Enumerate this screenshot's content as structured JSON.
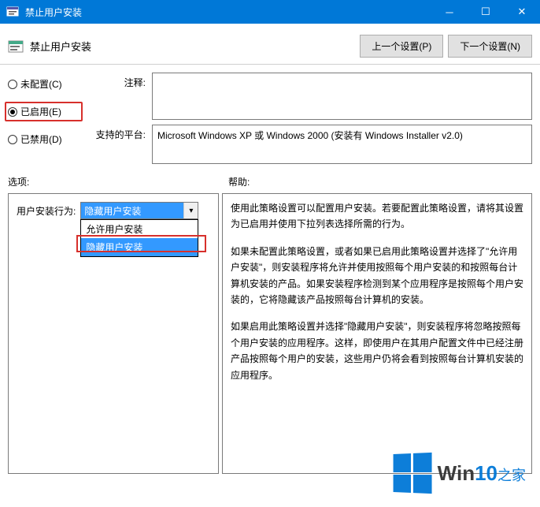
{
  "titlebar": {
    "title": "禁止用户安装"
  },
  "toprow": {
    "title": "禁止用户安装",
    "prev": "上一个设置(P)",
    "next": "下一个设置(N)"
  },
  "radios": {
    "unconfigured": "未配置(C)",
    "enabled": "已启用(E)",
    "disabled": "已禁用(D)"
  },
  "fields": {
    "comment_label": "注释:",
    "comment_value": "",
    "platform_label": "支持的平台:",
    "platform_value": "Microsoft Windows XP 或 Windows 2000 (安装有 Windows Installer v2.0)"
  },
  "mid": {
    "options": "选项:",
    "help": "帮助:"
  },
  "option": {
    "label": "用户安装行为:",
    "selected": "隐藏用户安装",
    "items": [
      "允许用户安装",
      "隐藏用户安装"
    ]
  },
  "help": {
    "p1": "使用此策略设置可以配置用户安装。若要配置此策略设置，请将其设置为已启用并使用下拉列表选择所需的行为。",
    "p2": "如果未配置此策略设置，或者如果已启用此策略设置并选择了\"允许用户安装\"，则安装程序将允许并使用按照每个用户安装的和按照每台计算机安装的产品。如果安装程序检测到某个应用程序是按照每个用户安装的，它将隐藏该产品按照每台计算机的安装。",
    "p3": "如果启用此策略设置并选择\"隐藏用户安装\"，则安装程序将忽略按照每个用户安装的应用程序。这样，即使用户在其用户配置文件中已经注册产品按照每个用户的安装，这些用户仍将会看到按照每台计算机安装的应用程序。"
  },
  "watermark": {
    "brand1": "Win",
    "brand2": "10",
    "sub": "之家"
  }
}
